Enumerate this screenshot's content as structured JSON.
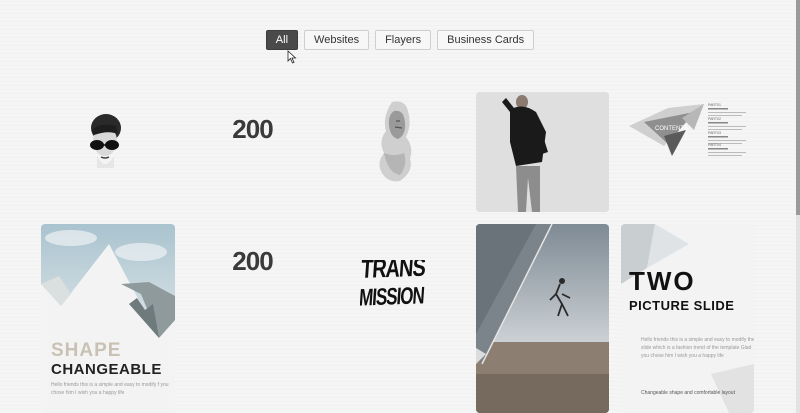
{
  "filters": [
    {
      "label": "All",
      "active": true
    },
    {
      "label": "Websites",
      "active": false
    },
    {
      "label": "Flayers",
      "active": false
    },
    {
      "label": "Business Cards",
      "active": false
    }
  ],
  "portfolio": {
    "logo_200_a": "200",
    "logo_200_b": "200",
    "contents": {
      "badge": "CONTENTS",
      "parts": [
        "PART01",
        "PART02",
        "PART03",
        "PART04"
      ]
    },
    "shape_card": {
      "title_top": "SHAPE",
      "title_bottom": "CHANGEABLE",
      "body": "Hello friends this is a simple and easy to modify f you chose him I wish you a happy life"
    },
    "transmission": {
      "line1": "TRANS",
      "line2": "MISSION"
    },
    "two_card": {
      "title": "TWO",
      "subtitle": "PICTURE SLIDE",
      "body": "Hello friends this is a simple and easy to modify the slide which is a fashion trend of the template Glad you chose him I wish you a happy life",
      "footer": "Changeable shape and comfortable layout"
    }
  }
}
